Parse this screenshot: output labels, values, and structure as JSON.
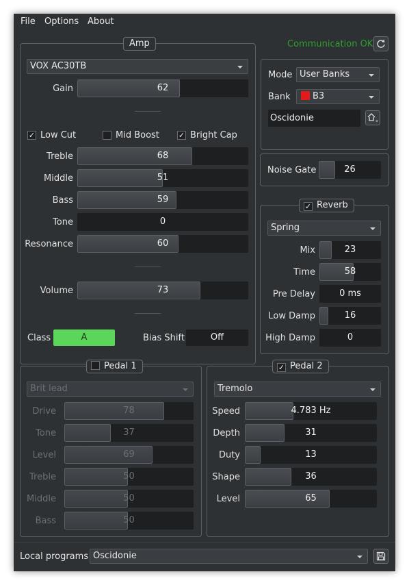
{
  "menu": {
    "items": [
      "File",
      "Options",
      "About"
    ]
  },
  "status": {
    "text": "Communication OK",
    "color": "#2e9e2e"
  },
  "amp": {
    "title": "Amp",
    "model": "VOX AC30TB",
    "gain": {
      "label": "Gain",
      "value": 62,
      "level": 0.6
    },
    "low_cut": {
      "label": "Low Cut",
      "checked": true
    },
    "mid_boost": {
      "label": "Mid Boost",
      "checked": false
    },
    "bright_cap": {
      "label": "Bright Cap",
      "checked": true
    },
    "treble": {
      "label": "Treble",
      "value": 68,
      "level": 0.67
    },
    "middle": {
      "label": "Middle",
      "value": 51,
      "level": 0.5
    },
    "bass": {
      "label": "Bass",
      "value": 59,
      "level": 0.58
    },
    "tone": {
      "label": "Tone",
      "value": 0,
      "level": 0.0
    },
    "resonance": {
      "label": "Resonance",
      "value": 60,
      "level": 0.59
    },
    "volume": {
      "label": "Volume",
      "value": 73,
      "level": 0.72
    },
    "class_label": "Class",
    "class_value": "A",
    "class_color": "#5bd65b",
    "bias_label": "Bias Shift",
    "bias_value": "Off"
  },
  "preset": {
    "mode_label": "Mode",
    "mode_value": "User Banks",
    "bank_label": "Bank",
    "bank_value": "B3",
    "bank_color": "#e21a1a",
    "name": "Oscidonie"
  },
  "noise_gate": {
    "label": "Noise Gate",
    "value": 26,
    "level": 0.26
  },
  "reverb": {
    "title": "Reverb",
    "enabled": true,
    "type": "Spring",
    "mix": {
      "label": "Mix",
      "value": "23",
      "level": 0.2
    },
    "time": {
      "label": "Time",
      "value": "58",
      "level": 0.56
    },
    "pre_delay": {
      "label": "Pre Delay",
      "value": "0 ms",
      "level": 0.0
    },
    "low_damp": {
      "label": "Low Damp",
      "value": "16",
      "level": 0.14
    },
    "high_damp": {
      "label": "High Damp",
      "value": "0",
      "level": 0.0
    }
  },
  "pedal1": {
    "title": "Pedal 1",
    "enabled": false,
    "type": "Brit lead",
    "drive": {
      "label": "Drive",
      "value": 78,
      "level": 0.77
    },
    "tone": {
      "label": "Tone",
      "value": 37,
      "level": 0.36
    },
    "level": {
      "label": "Level",
      "value": 69,
      "level": 0.68
    },
    "treble": {
      "label": "Treble",
      "value": 50,
      "level": 0.49
    },
    "middle": {
      "label": "Middle",
      "value": 50,
      "level": 0.49
    },
    "bass": {
      "label": "Bass",
      "value": 50,
      "level": 0.49
    }
  },
  "pedal2": {
    "title": "Pedal 2",
    "enabled": true,
    "type": "Tremolo",
    "speed": {
      "label": "Speed",
      "value": "4.783 Hz",
      "level": 0.37
    },
    "depth": {
      "label": "Depth",
      "value": "31",
      "level": 0.3
    },
    "duty": {
      "label": "Duty",
      "value": "13",
      "level": 0.12
    },
    "shape": {
      "label": "Shape",
      "value": "36",
      "level": 0.35
    },
    "level": {
      "label": "Level",
      "value": "65",
      "level": 0.64
    }
  },
  "footer": {
    "label": "Local programs",
    "program": "Oscidonie"
  },
  "icons": {
    "refresh": "refresh-icon",
    "up_menu": "up-arrow-menu-icon",
    "save": "save-icon"
  }
}
